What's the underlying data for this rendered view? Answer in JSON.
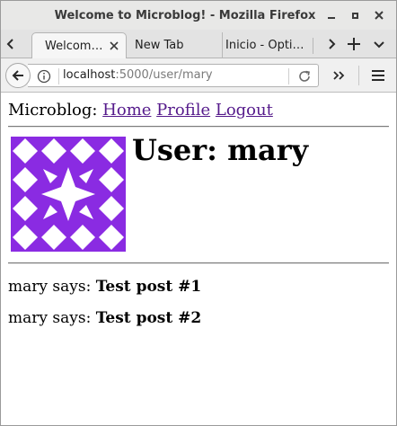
{
  "window": {
    "title": "Welcome to Microblog! - Mozilla Firefox"
  },
  "tabs": [
    {
      "label": "Welcom…",
      "active": true
    },
    {
      "label": "New Tab",
      "active": false
    },
    {
      "label": "Inicio - Opti…",
      "active": false
    }
  ],
  "navbar": {
    "url_host": "localhost",
    "url_path": ":5000/user/mary"
  },
  "icons": {
    "back": "back-arrow-icon",
    "info": "info-icon",
    "reload": "reload-icon",
    "overflow": "double-chevron-icon",
    "menu": "hamburger-menu-icon",
    "new_tab": "plus-icon"
  },
  "page": {
    "site_name": "Microblog:",
    "nav_links": [
      "Home",
      "Profile",
      "Logout"
    ],
    "heading": "User: mary",
    "avatar_alt": "identicon avatar",
    "posts": [
      {
        "author_text": "mary says:",
        "body": "Test post #1"
      },
      {
        "author_text": "mary says:",
        "body": "Test post #2"
      }
    ]
  },
  "colors": {
    "link": "#551a8b",
    "avatar": "#8a2be2"
  }
}
